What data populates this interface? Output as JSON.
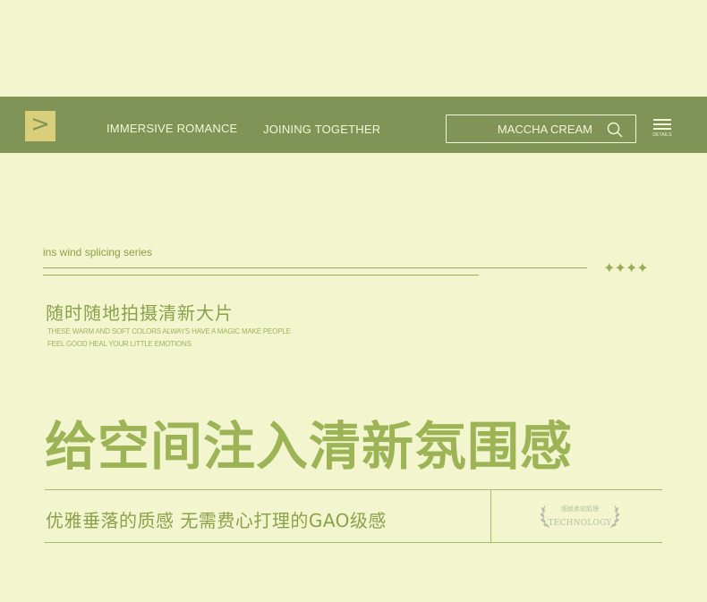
{
  "nav": {
    "arrow_symbol": ">",
    "link1": "IMMERSIVE ROMANCE",
    "link2": "JOINING TOGETHER",
    "search_text": "MACCHA CREAM",
    "details_label": "DETAILS"
  },
  "series": {
    "label": "ins wind splicing series",
    "stars": "✦✦✦✦"
  },
  "intro": {
    "cn_sub": "随时随地拍摄清新大片",
    "en_line1": "THESE WARM AND SOFT COLORS ALWAYS HAVE A MAGIC MAKE PEOPLE",
    "en_line2": "FEEL GOOD HEAL YOUR LITTLE EMOTIONS"
  },
  "headline": {
    "cn_big": "给空间注入清新氛围感"
  },
  "feature": {
    "text": "优雅垂落的质感  无需费心打理的GAO级感",
    "badge_cn": "细腻柔软肌理",
    "badge_en": "TECHNOLOGY"
  },
  "colors": {
    "background": "#f3f5cf",
    "navbar": "#7f9456",
    "accent_green": "#9cb455",
    "arrow_box": "#d9cf7a"
  }
}
